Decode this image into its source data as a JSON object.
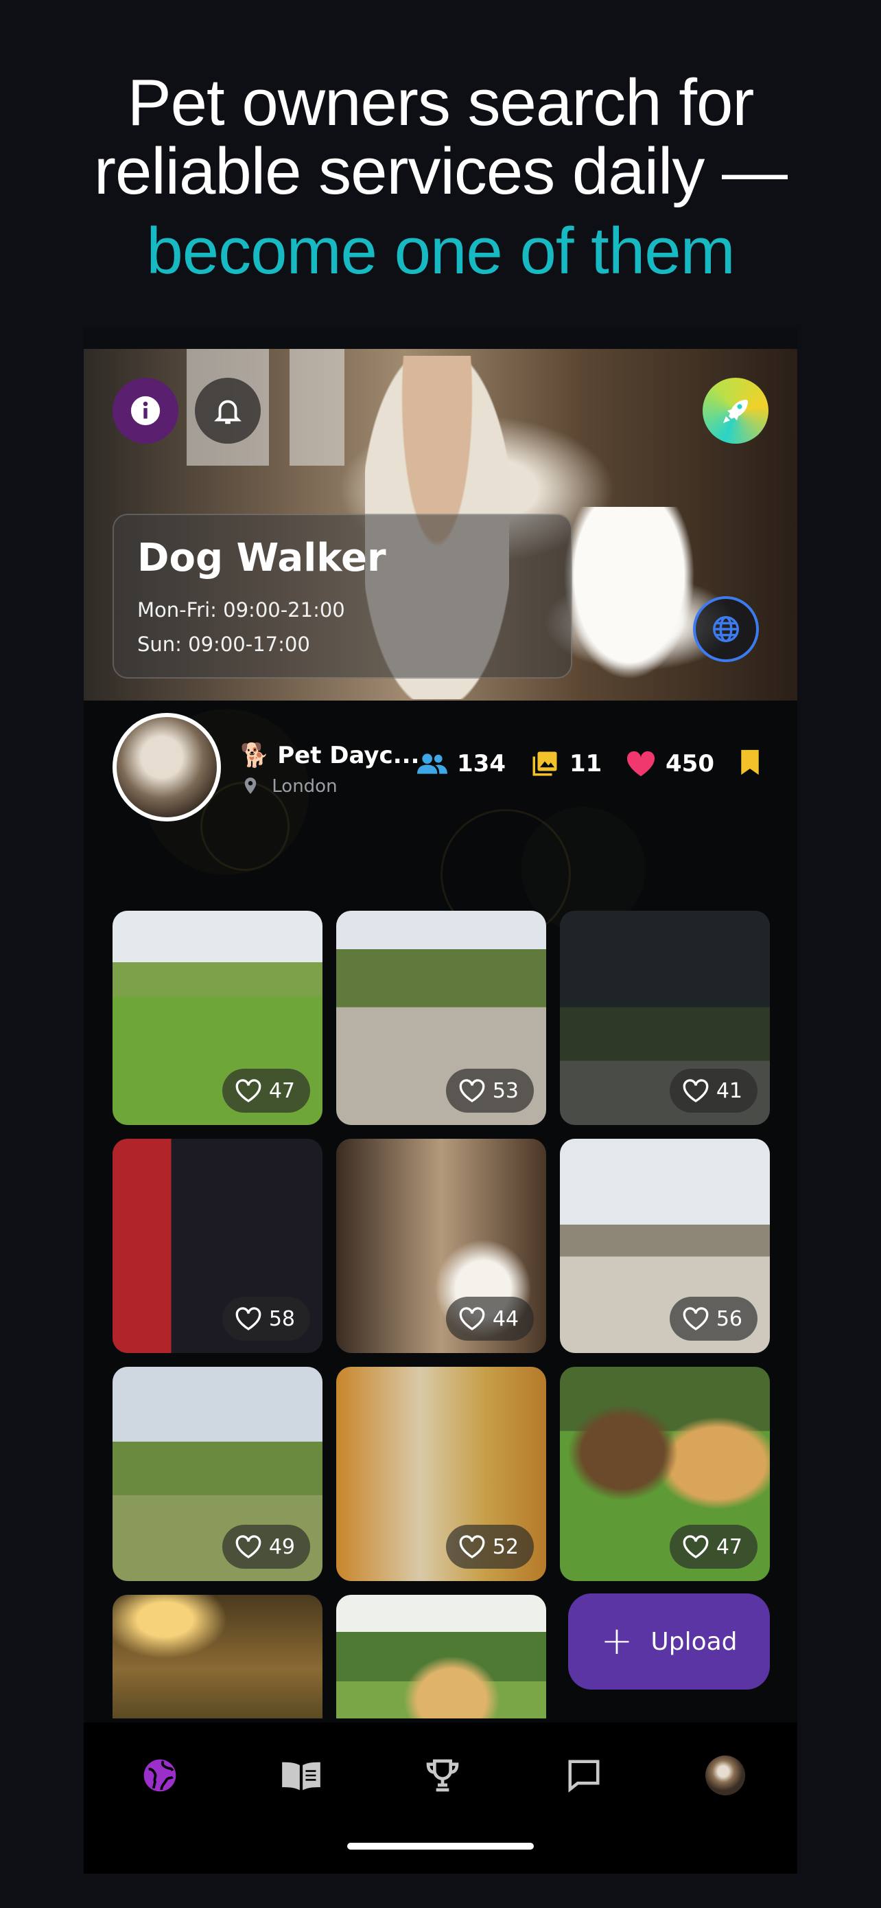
{
  "headline": {
    "line1": "Pet owners search for",
    "line2": "reliable services daily —",
    "line3": "become one of them"
  },
  "hero": {
    "title": "Dog Walker",
    "hours": [
      "Mon-Fri: 09:00-21:00",
      "Sun: 09:00-17:00"
    ],
    "icons": [
      "info-icon",
      "bell-icon",
      "rocket-icon",
      "globe-icon"
    ]
  },
  "profile": {
    "emoji": "🐕",
    "name": "Pet Dayc...",
    "location": "London",
    "stats": {
      "followers": "134",
      "photos": "11",
      "likes": "450"
    }
  },
  "photos": [
    {
      "likes": "47",
      "scene": "park-dogs"
    },
    {
      "likes": "53",
      "scene": "village-walk"
    },
    {
      "likes": "41",
      "scene": "night-park"
    },
    {
      "likes": "58",
      "scene": "london-bus"
    },
    {
      "likes": "44",
      "scene": "cafe-dog"
    },
    {
      "likes": "56",
      "scene": "big-ben"
    },
    {
      "likes": "49",
      "scene": "country-path"
    },
    {
      "likes": "52",
      "scene": "autumn-city"
    },
    {
      "likes": "47",
      "scene": "two-dogs"
    },
    {
      "likes": "",
      "scene": "sunset-play"
    },
    {
      "likes": "",
      "scene": "dog-ball"
    }
  ],
  "upload": {
    "label": "Upload"
  },
  "nav": {
    "items": [
      "globe-icon",
      "book-icon",
      "trophy-icon",
      "chat-icon",
      "avatar"
    ],
    "active_color": "#9b2fc9"
  },
  "colors": {
    "accent": "#17b9c2",
    "upload": "#5a35a3",
    "like_heart": "#f0376e",
    "photos_icon": "#f3c22b",
    "followers_icon": "#3fa7e6"
  }
}
